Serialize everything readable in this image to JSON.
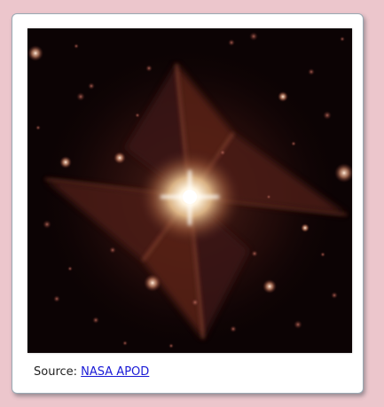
{
  "caption": {
    "prefix": "Source: ",
    "link_text": "NASA APOD"
  },
  "colors": {
    "page_background": "#ecc6cc",
    "card_background": "#ffffff",
    "link": "#1a1ad6"
  }
}
